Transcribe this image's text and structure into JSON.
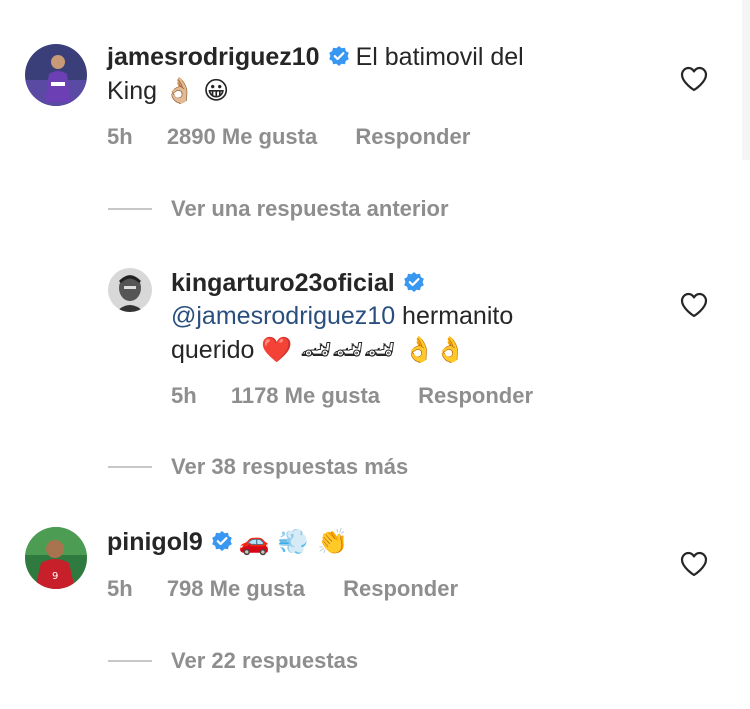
{
  "comments": [
    {
      "username": "jamesrodriguez10",
      "text_line1": "El batimovil del",
      "text_line2_text": "King",
      "text_line2_emoji": "👌🏼 😀",
      "time": "5h",
      "likes": "2890 Me gusta",
      "reply": "Responder"
    },
    {
      "username": "kingarturo23oficial",
      "mention": "@jamesrodriguez10",
      "text_line1_after": " hermanito",
      "text_line2_text": "querido",
      "text_line2_emoji": "❤️ 🏎🏎🏎 👌👌",
      "time": "5h",
      "likes": "1178 Me gusta",
      "reply": "Responder"
    },
    {
      "username": "pinigol9",
      "text_emoji": "🚗 💨 👏",
      "time": "5h",
      "likes": "798 Me gusta",
      "reply": "Responder"
    }
  ],
  "view_previous": "Ver una respuesta anterior",
  "view_more": "Ver 38 respuestas más",
  "view_replies": "Ver 22 respuestas",
  "icons": {
    "verified": "verified-badge-icon",
    "like": "heart-outline-icon"
  },
  "colors": {
    "verified_blue": "#3897f0",
    "meta_gray": "#8e8e8e",
    "mention_blue": "#2a4f7e"
  }
}
